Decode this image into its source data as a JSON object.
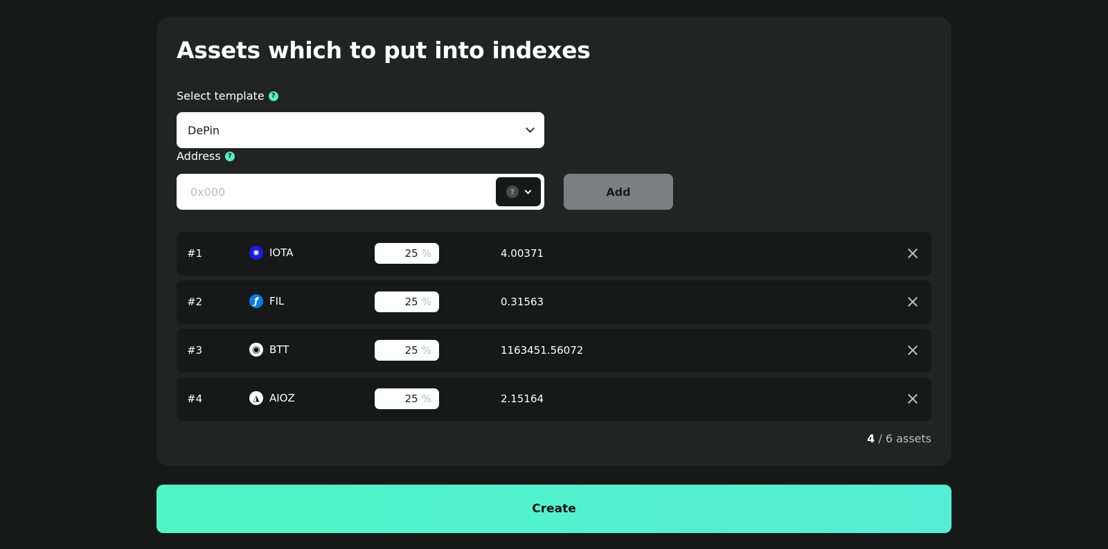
{
  "title": "Assets which to put into indexes",
  "template": {
    "label": "Select template",
    "help": "?",
    "selected": "DePin"
  },
  "address": {
    "label": "Address",
    "help": "?",
    "placeholder": "0x000",
    "picker_icon": "?"
  },
  "add_label": "Add",
  "assets": [
    {
      "index": "#1",
      "symbol": "IOTA",
      "icon": "iota-icon",
      "icon_color": "#1a1ae6",
      "icon_glyph": "✺",
      "percent": "25",
      "unit": "%",
      "amount": "4.00371"
    },
    {
      "index": "#2",
      "symbol": "FIL",
      "icon": "filecoin-icon",
      "icon_color": "#0a7ee0",
      "icon_glyph": "ƒ",
      "percent": "25",
      "unit": "%",
      "amount": "0.31563"
    },
    {
      "index": "#3",
      "symbol": "BTT",
      "icon": "bittorrent-icon",
      "icon_color": "#ffffff",
      "icon_glyph": "◉",
      "percent": "25",
      "unit": "%",
      "amount": "1163451.56072"
    },
    {
      "index": "#4",
      "symbol": "AIOZ",
      "icon": "aioz-icon",
      "icon_color": "#ffffff",
      "icon_glyph": "◮",
      "percent": "25",
      "unit": "%",
      "amount": "2.15164"
    }
  ],
  "count": {
    "current": "4",
    "separator": " / ",
    "total_text": "6 assets"
  },
  "create_label": "Create",
  "colors": {
    "accent": "#4ff5c6",
    "background": "#171818",
    "panel": "#222323"
  }
}
